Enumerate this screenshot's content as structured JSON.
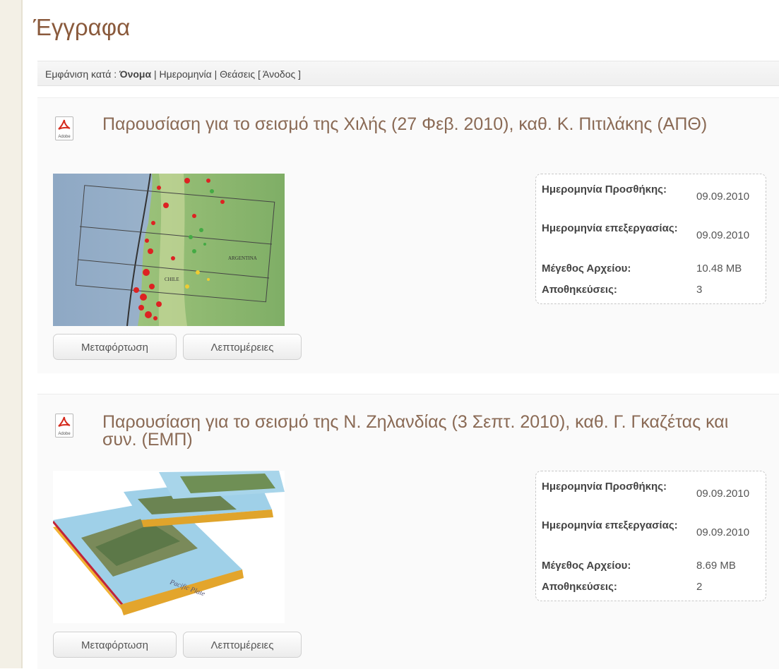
{
  "page": {
    "title": "Έγγραφα"
  },
  "sort": {
    "prefix": "Εμφάνιση κατά :",
    "name": "Όνομα",
    "sep1": "|",
    "date": "Ημερομηνία",
    "sep2": "|",
    "views": "Θεάσεις",
    "order": "[ Άνοδος ]"
  },
  "icons": {
    "document": "pdf-icon",
    "adobe_text": "Adobe"
  },
  "colors": {
    "title": "#8a5a3c",
    "doc_title": "#8a6a55",
    "pdf_red": "#d52b1e"
  },
  "labels": {
    "added": "Ημερομηνία Προσθήκης:",
    "modified": "Ημερομηνία επεξεργασίας:",
    "size": "Μέγεθος Αρχείου:",
    "downloads": "Αποθηκεύσεις:",
    "download_button": "Μεταφόρτωση",
    "details_button": "Λεπτομέρειες"
  },
  "documents": [
    {
      "title": "Παρουσίαση για το σεισμό της Χιλής (27 Φεβ. 2010), καθ. Κ. Πιτιλάκης (ΑΠΘ)",
      "added": "09.09.2010",
      "modified": "09.09.2010",
      "size": "10.48 MB",
      "downloads": "3",
      "map_labels": {
        "country1": "ARGENTINA",
        "country2": "CHILE"
      }
    },
    {
      "title": "Παρουσίαση για το σεισμό της Ν. Ζηλανδίας (3 Σεπτ. 2010), καθ. Γ. Γκαζέτας και συν. (ΕΜΠ)",
      "added": "09.09.2010",
      "modified": "09.09.2010",
      "size": "8.69 MB",
      "downloads": "2",
      "map_labels": {
        "plate": "Pacific Plate"
      }
    }
  ]
}
